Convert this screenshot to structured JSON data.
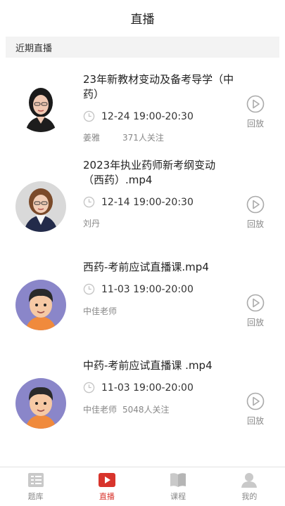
{
  "header": {
    "title": "直播"
  },
  "section": {
    "title": "近期直播"
  },
  "items": [
    {
      "title": "23年新教材变动及备考导学（中药）",
      "time": "12-24 19:00-20:30",
      "teacher": "姜雅",
      "follow": "371人关注",
      "replay": "回放"
    },
    {
      "title": "2023年执业药师新考纲变动（西药）.mp4",
      "time": "12-14 19:00-20:30",
      "teacher": "刘丹",
      "follow": "",
      "replay": "回放"
    },
    {
      "title": "西药-考前应试直播课.mp4",
      "time": "11-03 19:00-20:00",
      "teacher": "中佳老师",
      "follow": "",
      "replay": "回放"
    },
    {
      "title": "中药-考前应试直播课 .mp4",
      "time": "11-03 19:00-20:00",
      "teacher": "中佳老师",
      "follow": "5048人关注",
      "replay": "回放"
    }
  ],
  "tabs": [
    {
      "label": "题库",
      "icon": "question-bank-icon"
    },
    {
      "label": "直播",
      "icon": "live-icon",
      "active": true
    },
    {
      "label": "课程",
      "icon": "book-icon"
    },
    {
      "label": "我的",
      "icon": "user-icon"
    }
  ],
  "colors": {
    "accent": "#d8342c",
    "muted": "#888888",
    "icon_gray": "#bdbdbd",
    "cartoon_bg": "#8a86c9"
  }
}
